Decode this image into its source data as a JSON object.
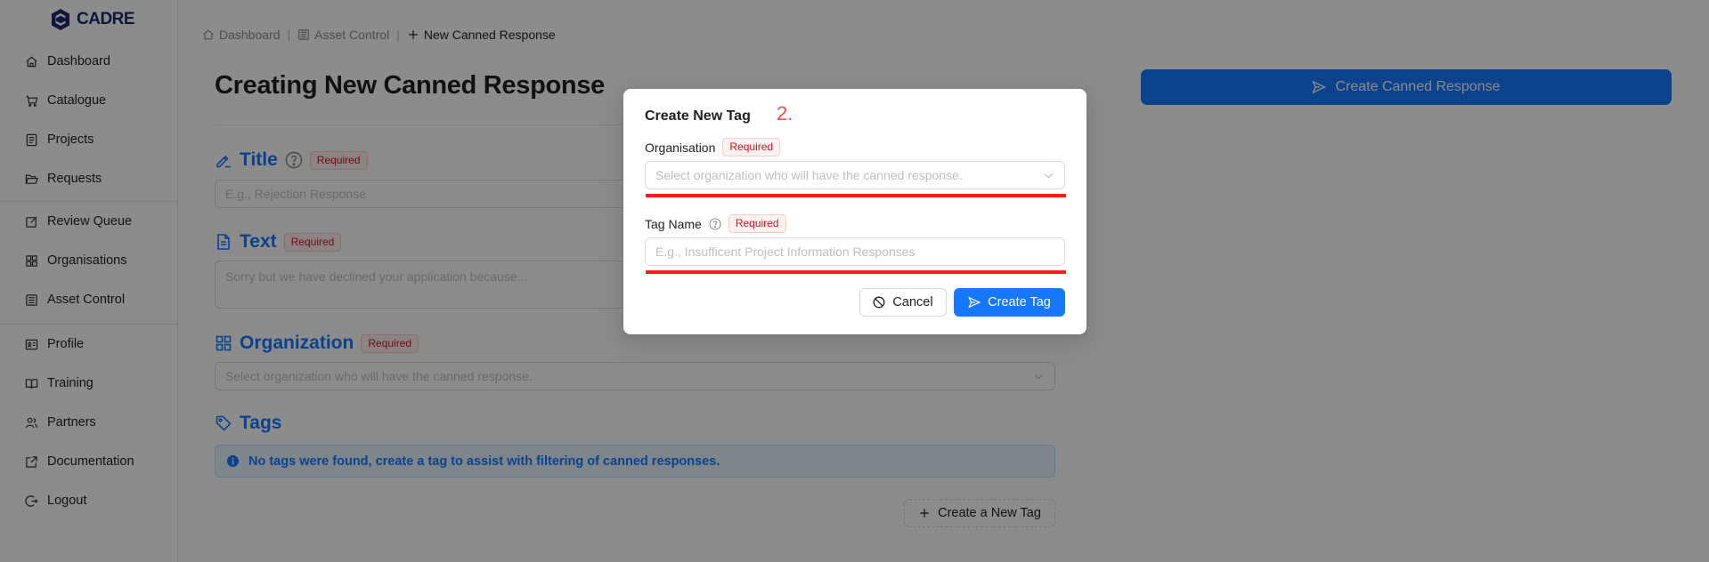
{
  "app": {
    "logo_text": "CADRE"
  },
  "sidebar": {
    "items": [
      {
        "label": "Dashboard",
        "icon": "home-icon"
      },
      {
        "label": "Catalogue",
        "icon": "cart-icon"
      },
      {
        "label": "Projects",
        "icon": "project-icon"
      },
      {
        "label": "Requests",
        "icon": "folder-open-icon"
      },
      {
        "label": "Review Queue",
        "icon": "edit-icon"
      },
      {
        "label": "Organisations",
        "icon": "appstore-icon"
      },
      {
        "label": "Asset Control",
        "icon": "bank-icon"
      },
      {
        "label": "Profile",
        "icon": "profile-icon"
      },
      {
        "label": "Training",
        "icon": "read-icon"
      },
      {
        "label": "Partners",
        "icon": "team-icon"
      },
      {
        "label": "Documentation",
        "icon": "export-icon"
      },
      {
        "label": "Logout",
        "icon": "logout-icon"
      }
    ]
  },
  "breadcrumb": {
    "items": [
      {
        "label": "Dashboard",
        "icon": "home-icon"
      },
      {
        "label": "Asset Control",
        "icon": "bank-icon"
      },
      {
        "label": "New Canned Response",
        "icon": "plus-icon"
      }
    ],
    "separator": "|"
  },
  "page": {
    "title": "Creating New Canned Response",
    "primary_action_label": "Create Canned Response"
  },
  "form": {
    "required_badge": "Required",
    "title": {
      "label": "Title",
      "placeholder": "E.g., Rejection Response"
    },
    "text": {
      "label": "Text",
      "placeholder": "Sorry but we have declined your application because..."
    },
    "organization": {
      "label": "Organization",
      "placeholder": "Select organization who will have the canned response."
    },
    "tags": {
      "label": "Tags",
      "empty_message": "No tags were found, create a tag to assist with filtering of canned responses.",
      "create_button_label": "Create a New Tag"
    }
  },
  "modal": {
    "title": "Create New Tag",
    "step_marker": "2.",
    "organisation": {
      "label": "Organisation",
      "placeholder": "Select organization who will have the canned response."
    },
    "tag_name": {
      "label": "Tag Name",
      "placeholder": "E.g., Insufficent Project Information Responses"
    },
    "cancel_label": "Cancel",
    "create_label": "Create Tag"
  },
  "colors": {
    "primary": "#1677ff",
    "required_text": "#cf1322",
    "annotation_red": "#ff1a1a",
    "logo_navy": "#1c2a6b"
  }
}
